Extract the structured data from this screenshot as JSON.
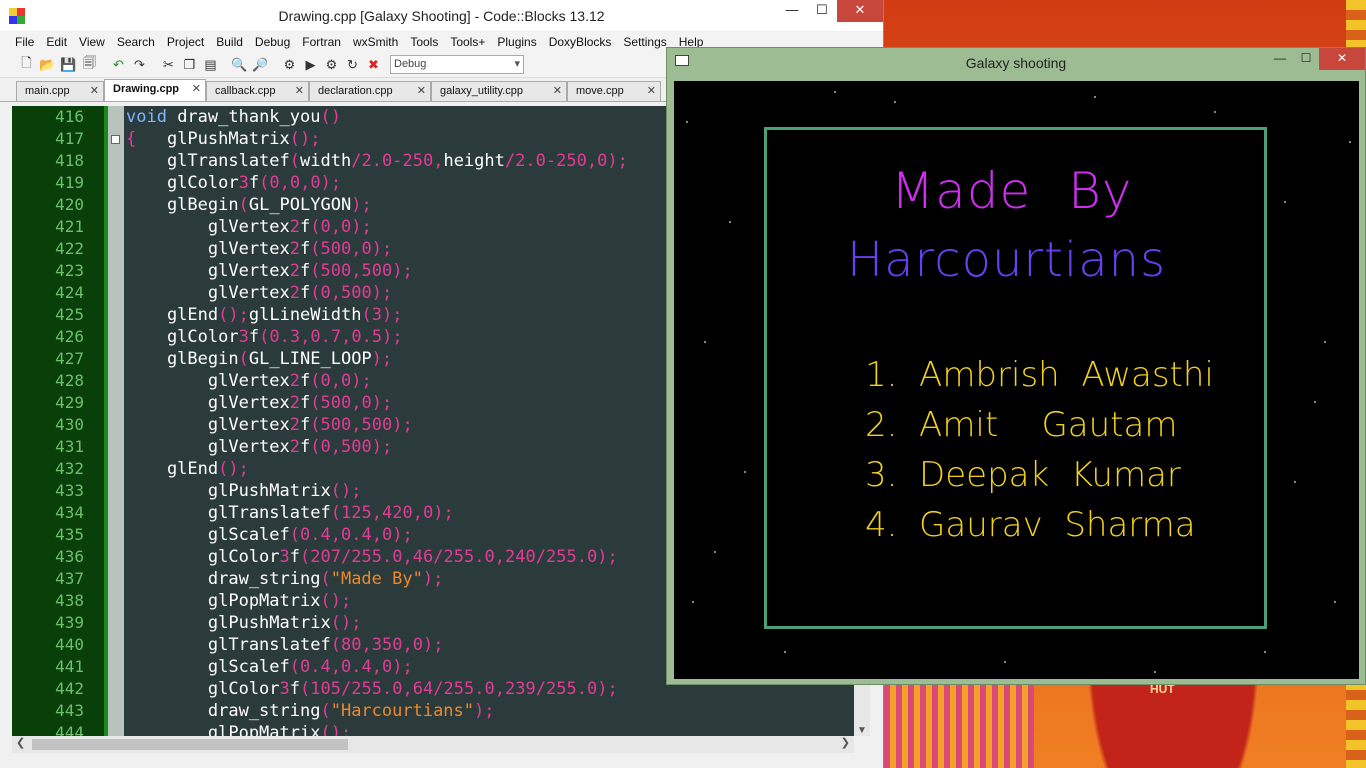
{
  "editor_window": {
    "title": "Drawing.cpp [Galaxy Shooting] - Code::Blocks 13.12",
    "controls": {
      "minimize": "—",
      "maximize": "☐",
      "close": "✕"
    },
    "menu": [
      "File",
      "Edit",
      "View",
      "Search",
      "Project",
      "Build",
      "Debug",
      "Fortran",
      "wxSmith",
      "Tools",
      "Tools+",
      "Plugins",
      "DoxyBlocks",
      "Settings",
      "Help"
    ],
    "toolbar": {
      "icons": [
        "new-file-icon",
        "open-icon",
        "save-icon",
        "save-all-icon",
        "undo-icon",
        "redo-icon",
        "cut-icon",
        "copy-icon",
        "paste-icon",
        "find-icon",
        "replace-icon",
        "build-icon",
        "run-icon",
        "build-run-icon",
        "rebuild-icon",
        "abort-icon"
      ],
      "build_target": "Debug"
    },
    "tabs": [
      {
        "label": "main.cpp",
        "active": false
      },
      {
        "label": "Drawing.cpp",
        "active": true
      },
      {
        "label": "callback.cpp",
        "active": false
      },
      {
        "label": "declaration.cpp",
        "active": false
      },
      {
        "label": "galaxy_utility.cpp",
        "active": false
      },
      {
        "label": "move.cpp",
        "active": false
      }
    ],
    "code_lines": [
      {
        "n": "416",
        "text": "void draw_thank_you()"
      },
      {
        "n": "417",
        "text": "{   glPushMatrix();"
      },
      {
        "n": "418",
        "text": "    glTranslatef(width/2.0-250,height/2.0-250,0);"
      },
      {
        "n": "419",
        "text": "    glColor3f(0,0,0);"
      },
      {
        "n": "420",
        "text": "    glBegin(GL_POLYGON);"
      },
      {
        "n": "421",
        "text": "        glVertex2f(0,0);"
      },
      {
        "n": "422",
        "text": "        glVertex2f(500,0);"
      },
      {
        "n": "423",
        "text": "        glVertex2f(500,500);"
      },
      {
        "n": "424",
        "text": "        glVertex2f(0,500);"
      },
      {
        "n": "425",
        "text": "    glEnd();glLineWidth(3);"
      },
      {
        "n": "426",
        "text": "    glColor3f(0.3,0.7,0.5);"
      },
      {
        "n": "427",
        "text": "    glBegin(GL_LINE_LOOP);"
      },
      {
        "n": "428",
        "text": "        glVertex2f(0,0);"
      },
      {
        "n": "429",
        "text": "        glVertex2f(500,0);"
      },
      {
        "n": "430",
        "text": "        glVertex2f(500,500);"
      },
      {
        "n": "431",
        "text": "        glVertex2f(0,500);"
      },
      {
        "n": "432",
        "text": "    glEnd();"
      },
      {
        "n": "433",
        "text": "        glPushMatrix();"
      },
      {
        "n": "434",
        "text": "        glTranslatef(125,420,0);"
      },
      {
        "n": "435",
        "text": "        glScalef(0.4,0.4,0);"
      },
      {
        "n": "436",
        "text": "        glColor3f(207/255.0,46/255.0,240/255.0);"
      },
      {
        "n": "437",
        "text": "        draw_string(\"Made By\");"
      },
      {
        "n": "438",
        "text": "        glPopMatrix();"
      },
      {
        "n": "439",
        "text": "        glPushMatrix();"
      },
      {
        "n": "440",
        "text": "        glTranslatef(80,350,0);"
      },
      {
        "n": "441",
        "text": "        glScalef(0.4,0.4,0);"
      },
      {
        "n": "442",
        "text": "        glColor3f(105/255.0,64/255.0,239/255.0);"
      },
      {
        "n": "443",
        "text": "        draw_string(\"Harcourtians\");"
      },
      {
        "n": "444",
        "text": "        glPopMatrix();"
      }
    ],
    "colors": {
      "editor_bg": "#2b3a3b",
      "gutter_bg": "#094009",
      "keyword": "#7db6ff",
      "punct": "#e03c96",
      "string": "#ec8a2b"
    }
  },
  "galaxy_window": {
    "title": "Galaxy shooting",
    "controls": {
      "minimize": "—",
      "maximize": "☐",
      "close": "✕"
    },
    "heading_1": "Made By",
    "heading_2": "Harcourtians",
    "names": [
      "1.  Ambrish  Awasthi",
      "2.  Amit    Gautam",
      "3.  Deepak  Kumar",
      "4.  Gaurav  Sharma"
    ],
    "colors": {
      "heading_1": "#cf2ef0",
      "heading_2": "#6940ef",
      "names": "#f2d21b",
      "border": "#4c9f7a"
    }
  },
  "wallpaper": {
    "text": "HUT"
  }
}
